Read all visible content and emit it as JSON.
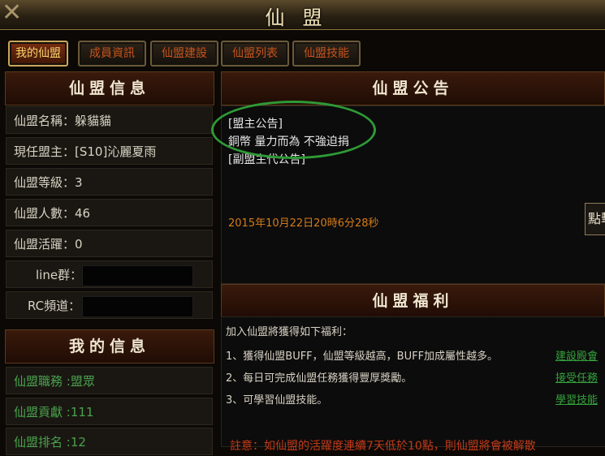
{
  "window": {
    "title": "仙盟",
    "close_icon": "✕"
  },
  "tabs": [
    {
      "label": "我的仙盟",
      "active": true
    },
    {
      "label": "成員資訊",
      "active": false
    },
    {
      "label": "仙盟建設",
      "active": false
    },
    {
      "label": "仙盟列表",
      "active": false
    },
    {
      "label": "仙盟技能",
      "active": false
    }
  ],
  "guild_info": {
    "header": "仙盟信息",
    "name": "仙盟名稱：躲貓貓",
    "leader": "現任盟主：[S10]沁麗夏雨",
    "level": "仙盟等級：3",
    "members": "仙盟人數：46",
    "activity": "仙盟活躍：0",
    "line_label": "line群：",
    "rc_label": "RC頻道："
  },
  "my_info": {
    "header": "我的信息",
    "position": "仙盟職務 :盟眾",
    "contribution": "仙盟貢獻 :111",
    "rank": "仙盟排名 :12"
  },
  "notice": {
    "header": "仙盟公告",
    "lines": [
      "[盟主公告]",
      "銅幣 量力而為  不強迫捐",
      "[副盟主代公告]"
    ],
    "date": "2015年10月22日20時6分28秒",
    "button": "點擊"
  },
  "welfare": {
    "header": "仙盟福利",
    "intro": "加入仙盟將獲得如下福利：",
    "items": [
      {
        "text": "1、獲得仙盟BUFF，仙盟等級越高，BUFF加成屬性越多。",
        "link": "建設殿會"
      },
      {
        "text": "2、每日可完成仙盟任務獲得豐厚獎勵。",
        "link": "接受任務"
      },
      {
        "text": "3、可學習仙盟技能。",
        "link": "學習技能"
      }
    ],
    "warning": "註意：如仙盟的活躍度連續7天低於10點，則仙盟將會被解散"
  },
  "colors": {
    "annotation_circle": "#2e9a36",
    "link": "#35a33c",
    "date": "#d77b19",
    "warning": "#c33a18"
  }
}
